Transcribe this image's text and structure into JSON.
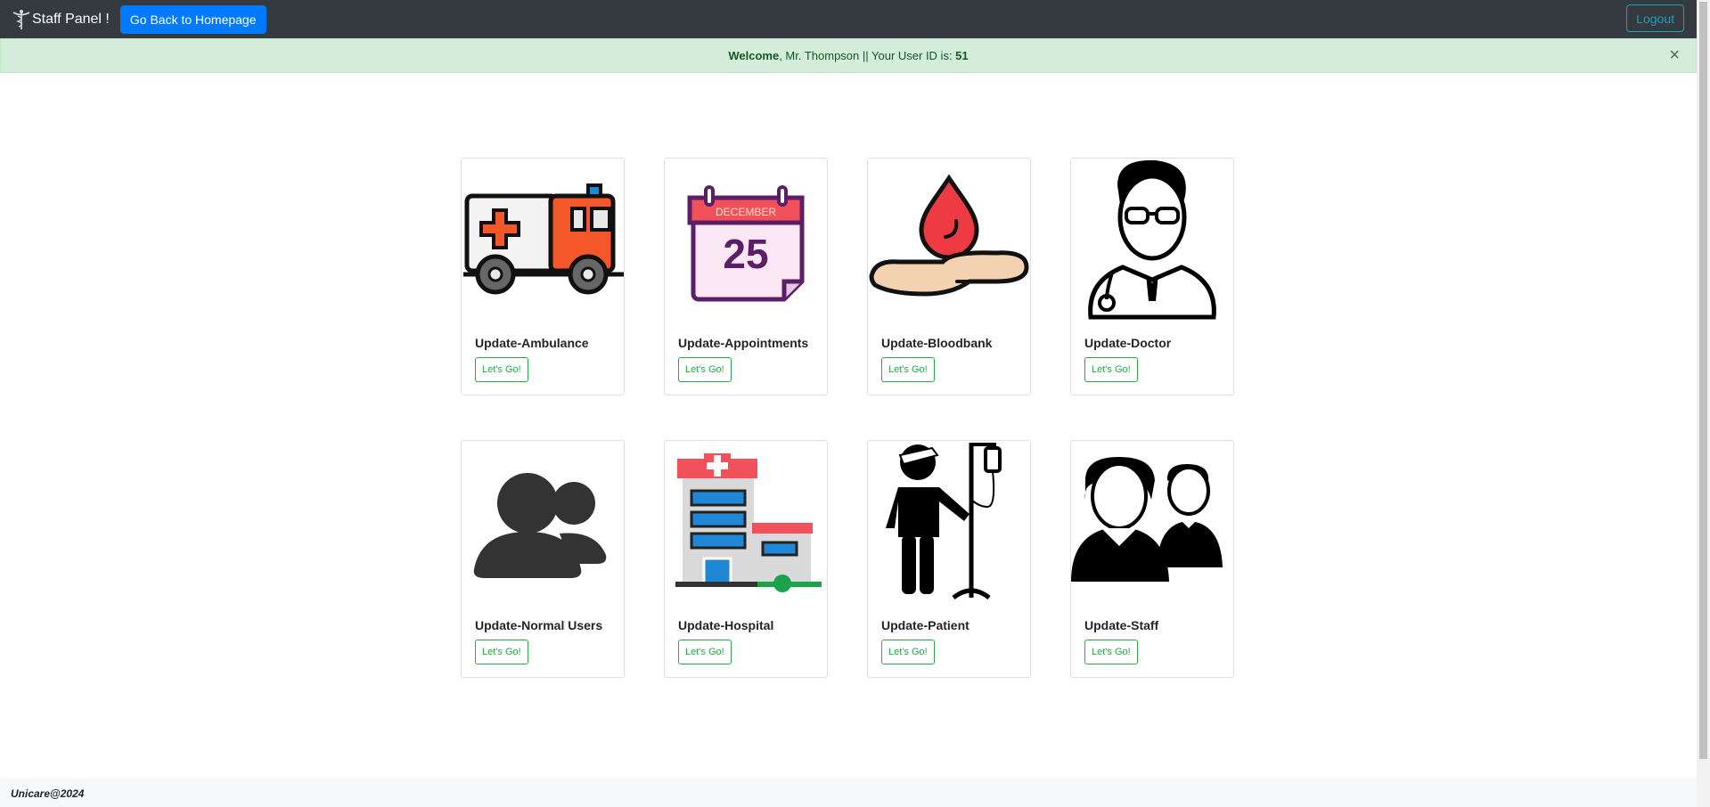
{
  "navbar": {
    "brand": "Staff Panel !",
    "home_button": "Go Back to Homepage",
    "logout_button": "Logout"
  },
  "alert": {
    "welcome": "Welcome",
    "message": ", Mr. Thompson || Your User ID is: ",
    "user_id": "51",
    "close": "×"
  },
  "cards": [
    {
      "title": "Update-Ambulance",
      "button": "Let's Go!",
      "icon": "ambulance-icon"
    },
    {
      "title": "Update-Appointments",
      "button": "Let's Go!",
      "icon": "calendar-icon",
      "calendar_month": "DECEMBER",
      "calendar_day": "25"
    },
    {
      "title": "Update-Bloodbank",
      "button": "Let's Go!",
      "icon": "blood-drop-hand-icon"
    },
    {
      "title": "Update-Doctor",
      "button": "Let's Go!",
      "icon": "doctor-icon"
    },
    {
      "title": "Update-Normal Users",
      "button": "Let's Go!",
      "icon": "users-icon"
    },
    {
      "title": "Update-Hospital",
      "button": "Let's Go!",
      "icon": "hospital-icon"
    },
    {
      "title": "Update-Patient",
      "button": "Let's Go!",
      "icon": "patient-iv-icon"
    },
    {
      "title": "Update-Staff",
      "button": "Let's Go!",
      "icon": "staff-icon"
    }
  ],
  "footer": {
    "text": "Unicare@2024"
  },
  "colors": {
    "navbar": "#343a40",
    "primary": "#007bff",
    "info": "#17a2b8",
    "success": "#28a745",
    "alert_bg": "#d4edda"
  }
}
